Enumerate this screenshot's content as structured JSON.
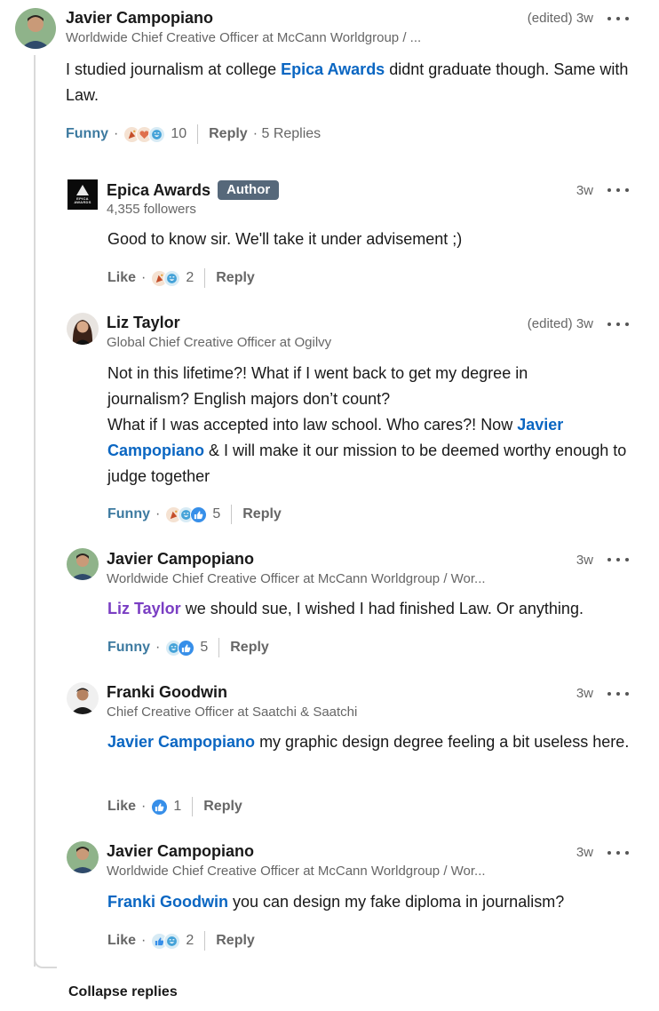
{
  "comments": [
    {
      "name": "Javier Campopiano",
      "headline": "Worldwide Chief Creative Officer at McCann Worldgroup / ...",
      "edited": "(edited)",
      "time": "3w",
      "text_before": "I studied journalism at college ",
      "mention": "Epica Awards",
      "text_after": " didnt graduate though. Same with Law.",
      "reaction_label": "Funny",
      "reaction_icons": [
        "celebrate-icon",
        "love-icon",
        "funny-icon"
      ],
      "reaction_count": "10",
      "reply_label": "Reply",
      "replies_count": "· 5 Replies"
    },
    {
      "name": "Epica Awards",
      "badge": "Author",
      "followers": "4,355 followers",
      "logo_text": "EPICA AWARDS",
      "time": "3w",
      "text": "Good to know sir. We'll take it under advisement ;)",
      "reaction_label": "Like",
      "reaction_icons": [
        "celebrate-icon",
        "funny-icon"
      ],
      "reaction_count": "2",
      "reply_label": "Reply"
    },
    {
      "name": "Liz Taylor",
      "headline": "Global Chief Creative Officer at Ogilvy",
      "edited": "(edited)",
      "time": "3w",
      "line1": "Not in this lifetime?! What if I went back to get my degree in",
      "line2": "journalism? English majors don’t count?",
      "line3_before": "What if I was accepted into law school. Who cares?! Now ",
      "mention": "Javier Campopiano",
      "line3_after": " & I will make it our mission to be deemed worthy enough to judge together",
      "reaction_label": "Funny",
      "reaction_icons": [
        "celebrate-icon",
        "funny-icon",
        "like-icon"
      ],
      "reaction_count": "5",
      "reply_label": "Reply"
    },
    {
      "name": "Javier Campopiano",
      "headline": "Worldwide Chief Creative Officer at McCann Worldgroup / Wor...",
      "time": "3w",
      "mention": "Liz Taylor",
      "text_after": " we should sue, I wished I had finished Law. Or anything.",
      "reaction_label": "Funny",
      "reaction_icons": [
        "funny-icon",
        "like-icon"
      ],
      "reaction_count": "5",
      "reply_label": "Reply"
    },
    {
      "name": "Franki Goodwin",
      "headline": "Chief Creative Officer at Saatchi & Saatchi",
      "time": "3w",
      "mention": "Javier Campopiano",
      "text_after": " my graphic design degree feeling a bit useless here.",
      "reaction_label": "Like",
      "reaction_icons": [
        "like-icon"
      ],
      "reaction_count": "1",
      "reply_label": "Reply"
    },
    {
      "name": "Javier Campopiano",
      "headline": "Worldwide Chief Creative Officer at McCann Worldgroup / Wor...",
      "time": "3w",
      "mention": "Franki Goodwin",
      "text_after": " you can design my fake diploma in journalism?",
      "reaction_label": "Like",
      "reaction_icons": [
        "love-icon",
        "funny-icon"
      ],
      "reaction_count": "2",
      "reply_label": "Reply"
    }
  ],
  "collapse_label": "Collapse replies",
  "colors": {
    "mention": "#0a66c2",
    "mention_purple": "#7a3ec3",
    "funny_label": "#3d7aa0",
    "badge": "#56687a",
    "thread_line": "#d9d9d9"
  }
}
